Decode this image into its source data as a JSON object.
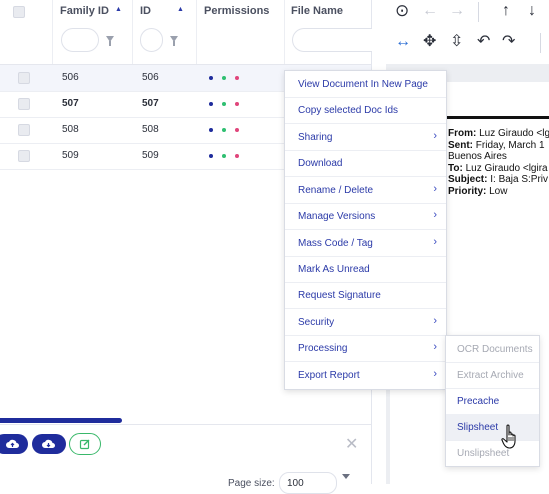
{
  "grid": {
    "columns": [
      {
        "label": "Family ID",
        "sort": "▲"
      },
      {
        "label": "ID",
        "sort": "▲"
      },
      {
        "label": "Permissions",
        "sort": ""
      },
      {
        "label": "File Name",
        "sort": ""
      }
    ],
    "rows": [
      {
        "family_id": "506",
        "id": "506",
        "selected": true,
        "bold": false
      },
      {
        "family_id": "507",
        "id": "507",
        "selected": false,
        "bold": true
      },
      {
        "family_id": "508",
        "id": "508",
        "selected": false,
        "bold": false
      },
      {
        "family_id": "509",
        "id": "509",
        "selected": false,
        "bold": false
      }
    ],
    "permission_colors": [
      "#1f2c9c",
      "#2fbf71",
      "#e0457b"
    ]
  },
  "footer": {
    "page_size_label": "Page size:",
    "page_size_value": "100",
    "progress": 0.33
  },
  "context_menu": {
    "items": [
      {
        "label": "View Document In New Page",
        "submenu": false
      },
      {
        "label": "Copy selected Doc Ids",
        "submenu": false
      },
      {
        "label": "Sharing",
        "submenu": true
      },
      {
        "label": "Download",
        "submenu": false
      },
      {
        "label": "Rename / Delete",
        "submenu": true
      },
      {
        "label": "Manage Versions",
        "submenu": true
      },
      {
        "label": "Mass Code / Tag",
        "submenu": true
      },
      {
        "label": "Mark As Unread",
        "submenu": false
      },
      {
        "label": "Request Signature",
        "submenu": false
      },
      {
        "label": "Security",
        "submenu": true
      },
      {
        "label": "Processing",
        "submenu": true
      },
      {
        "label": "Export Report",
        "submenu": true
      }
    ]
  },
  "processing_submenu": {
    "items": [
      {
        "label": "OCR Documents",
        "state": "disabled"
      },
      {
        "label": "Extract Archive",
        "state": "disabled"
      },
      {
        "label": "Precache",
        "state": "enabled"
      },
      {
        "label": "Slipsheet",
        "state": "hover"
      },
      {
        "label": "Unslipsheet",
        "state": "disabled"
      }
    ]
  },
  "email": {
    "from_label": "From:",
    "from_value": "Luz Giraudo <lg",
    "sent_label": "Sent:",
    "sent_value": "Friday, March 1",
    "city": "Buenos Aires",
    "to_label": "To:",
    "to_value": "Luz Giraudo <lgira",
    "subject_label": "Subject:",
    "subject_value": "I: Baja S:Priv",
    "priority_label": "Priority:",
    "priority_value": "Low"
  },
  "icons": {
    "circle_arrow": "⊙",
    "back": "←",
    "forward": "→",
    "up": "↑",
    "down": "↓",
    "fit_width": "↔",
    "move": "✥",
    "fit_height": "⇳",
    "rotate_left": "↶",
    "rotate_right": "↷",
    "close": "✕"
  }
}
